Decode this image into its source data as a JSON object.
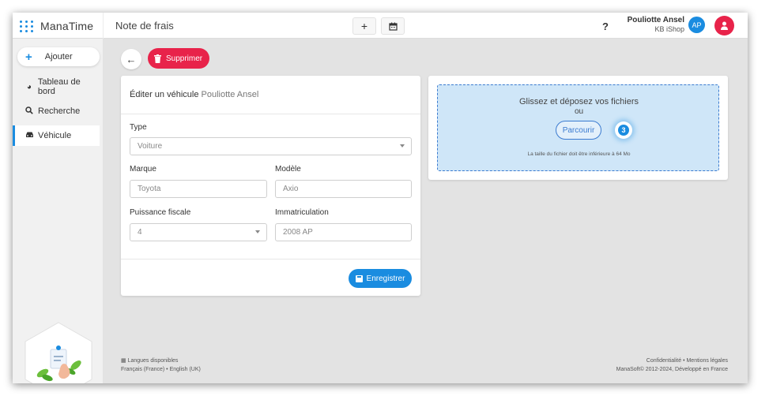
{
  "brand": {
    "name": "ManaTime",
    "icon": "grid-dots-icon",
    "accent": "#1a8ce0"
  },
  "header": {
    "title": "Note de frais",
    "add_icon": "+",
    "calendar_icon": "calendar-icon",
    "help": "?",
    "user_name": "Pouliotte Ansel",
    "user_company": "KB iShop",
    "avatar": "AP",
    "alert_icon": "user-alert-icon"
  },
  "sidebar": {
    "add_label": "Ajouter",
    "items": [
      {
        "label": "Tableau de bord",
        "icon": "pie-chart-icon"
      },
      {
        "label": "Recherche",
        "icon": "search-icon"
      },
      {
        "label": "Véhicule",
        "icon": "car-icon"
      }
    ]
  },
  "actions": {
    "back": "←",
    "delete_label": "Supprimer"
  },
  "form": {
    "title": "Éditer un véhicule",
    "title_owner": "Pouliotte Ansel",
    "type_label": "Type",
    "type_value": "Voiture",
    "brand_label": "Marque",
    "brand_value": "Toyota",
    "model_label": "Modèle",
    "model_value": "Axio",
    "power_label": "Puissance fiscale",
    "power_value": "4",
    "plate_label": "Immatriculation",
    "plate_value": "2008 AP",
    "save_label": "Enregistrer"
  },
  "upload": {
    "title": "Glissez et déposez vos fichiers",
    "or": "ou",
    "browse_label": "Parcourir",
    "step_badge": "3",
    "note": "La taille du fichier doit être inférieure à 64 Mo"
  },
  "footer": {
    "languages_title": "Langues disponibles",
    "languages": "Français (France) • English (UK)",
    "links": "Confidentialité • Mentions légales",
    "copyright": "ManaSoft© 2012-2024, Développé en France"
  },
  "colors": {
    "primary": "#1a8ce0",
    "danger": "#e8234a",
    "dropzone": "#cfe6f8"
  }
}
